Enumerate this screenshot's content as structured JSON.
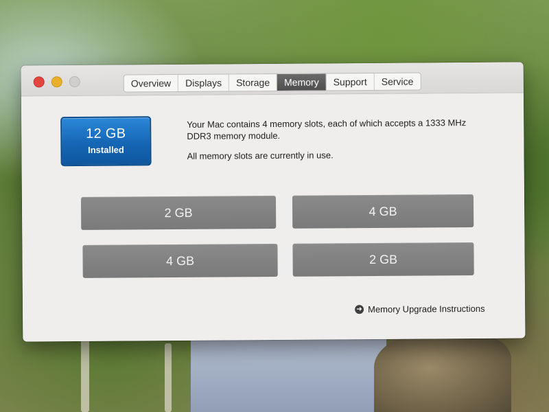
{
  "window": {
    "tabs": [
      {
        "label": "Overview"
      },
      {
        "label": "Displays"
      },
      {
        "label": "Storage"
      },
      {
        "label": "Memory"
      },
      {
        "label": "Support"
      },
      {
        "label": "Service"
      }
    ],
    "active_tab": "Memory"
  },
  "memory": {
    "installed_size": "12 GB",
    "installed_label": "Installed",
    "description_line1": "Your Mac contains 4 memory slots, each of which accepts a 1333 MHz DDR3 memory module.",
    "description_line2": "All memory slots are currently in use.",
    "slots": [
      {
        "size": "2 GB"
      },
      {
        "size": "4 GB"
      },
      {
        "size": "4 GB"
      },
      {
        "size": "2 GB"
      }
    ],
    "upgrade_link": "Memory Upgrade Instructions"
  },
  "colors": {
    "badge_blue": "#1566b5",
    "slot_gray": "#7e7e7e",
    "close_red": "#e2463f",
    "minimize_yellow": "#e8b02b"
  },
  "icons": {
    "upgrade_link_icon": "arrow-circle-right-icon"
  }
}
